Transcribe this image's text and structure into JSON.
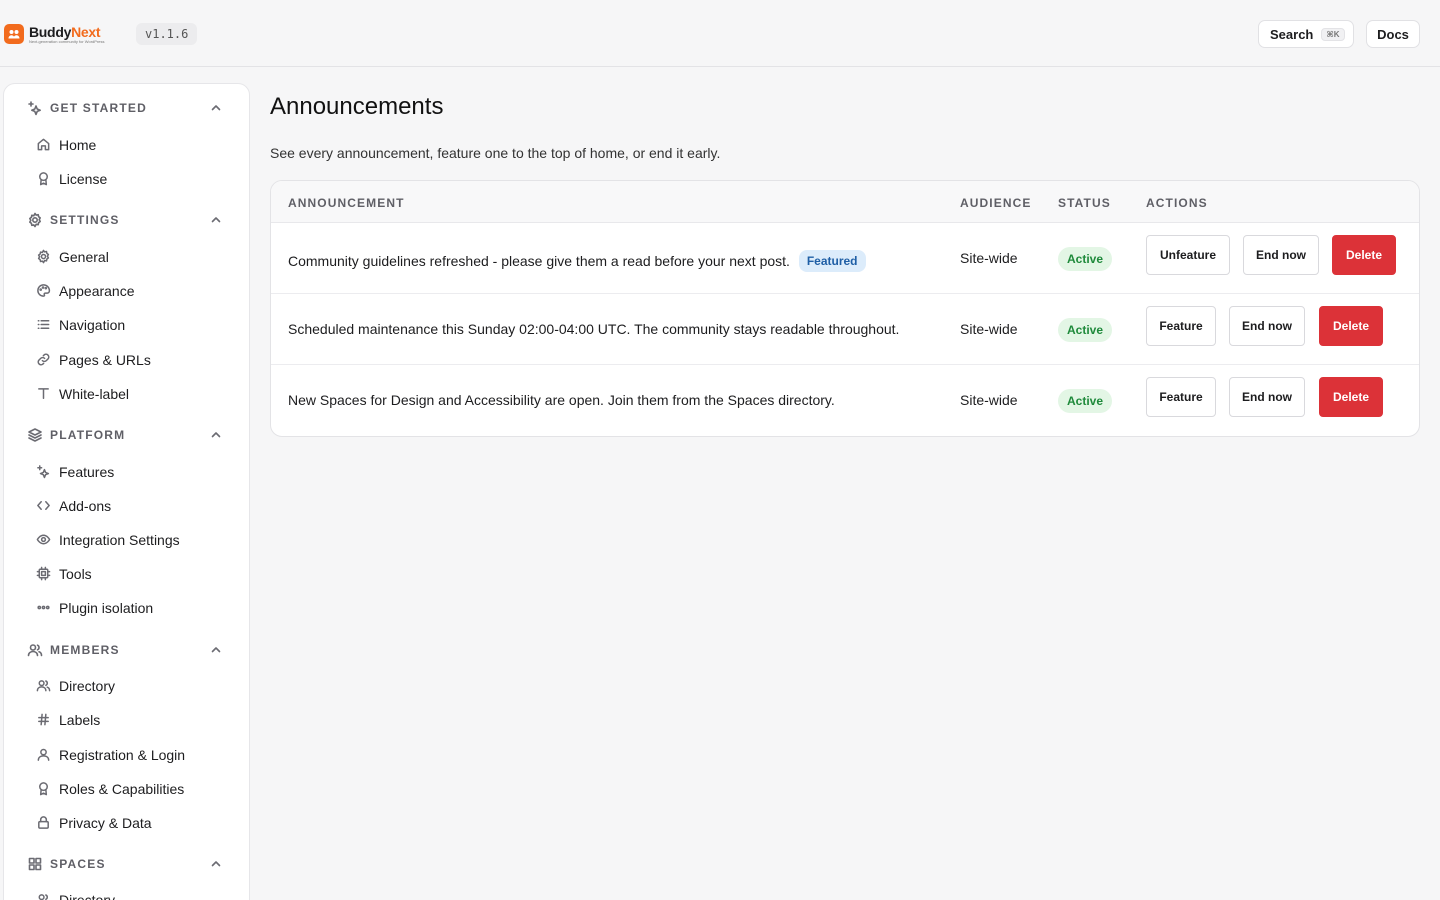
{
  "brand": {
    "name_part1": "Buddy",
    "name_part2": "Next",
    "tagline": "Next-generation community for WordPress",
    "version": "v1.1.6",
    "accent": "#f26b1d"
  },
  "topbar": {
    "search_label": "Search",
    "search_shortcut": "⌘K",
    "docs_label": "Docs"
  },
  "sidebar": {
    "sections": [
      {
        "label": "GET STARTED",
        "icon": "sparkles-icon",
        "items": [
          {
            "label": "Home",
            "icon": "home-icon"
          },
          {
            "label": "License",
            "icon": "award-icon"
          }
        ]
      },
      {
        "label": "SETTINGS",
        "icon": "gear-icon",
        "items": [
          {
            "label": "General",
            "icon": "gear-icon"
          },
          {
            "label": "Appearance",
            "icon": "palette-icon"
          },
          {
            "label": "Navigation",
            "icon": "list-icon"
          },
          {
            "label": "Pages & URLs",
            "icon": "link-icon"
          },
          {
            "label": "White-label",
            "icon": "type-icon"
          }
        ]
      },
      {
        "label": "PLATFORM",
        "icon": "layers-icon",
        "items": [
          {
            "label": "Features",
            "icon": "sparkles-icon"
          },
          {
            "label": "Add-ons",
            "icon": "code-icon"
          },
          {
            "label": "Integration Settings",
            "icon": "eye-icon"
          },
          {
            "label": "Tools",
            "icon": "cpu-icon"
          },
          {
            "label": "Plugin isolation",
            "icon": "dots-icon"
          }
        ]
      },
      {
        "label": "MEMBERS",
        "icon": "users-icon",
        "items": [
          {
            "label": "Directory",
            "icon": "users-icon"
          },
          {
            "label": "Labels",
            "icon": "hash-icon"
          },
          {
            "label": "Registration & Login",
            "icon": "user-icon"
          },
          {
            "label": "Roles & Capabilities",
            "icon": "award-icon"
          },
          {
            "label": "Privacy & Data",
            "icon": "lock-icon"
          }
        ]
      },
      {
        "label": "SPACES",
        "icon": "grid-icon",
        "items": [
          {
            "label": "Directory",
            "icon": "users-icon"
          }
        ]
      }
    ]
  },
  "main": {
    "title": "Announcements",
    "description": "See every announcement, feature one to the top of home, or end it early.",
    "columns": [
      "ANNOUNCEMENT",
      "AUDIENCE",
      "STATUS",
      "ACTIONS"
    ],
    "rows": [
      {
        "text": "Community guidelines refreshed - please give them a read before your next post.",
        "badge": "Featured",
        "audience": "Site-wide",
        "status": "Active",
        "feature_action": "Unfeature",
        "end_action": "End now",
        "delete_action": "Delete"
      },
      {
        "text": "Scheduled maintenance this Sunday 02:00-04:00 UTC. The community stays readable throughout.",
        "badge": "",
        "audience": "Site-wide",
        "status": "Active",
        "feature_action": "Feature",
        "end_action": "End now",
        "delete_action": "Delete"
      },
      {
        "text": "New Spaces for Design and Accessibility are open. Join them from the Spaces directory.",
        "badge": "",
        "audience": "Site-wide",
        "status": "Active",
        "feature_action": "Feature",
        "end_action": "End now",
        "delete_action": "Delete"
      }
    ]
  },
  "colors": {
    "status_active_bg": "#e3f6e5",
    "status_active_text": "#1f8a3b",
    "featured_bg": "#dcecfb",
    "featured_text": "#1f5fa6",
    "danger": "#dc3238"
  }
}
